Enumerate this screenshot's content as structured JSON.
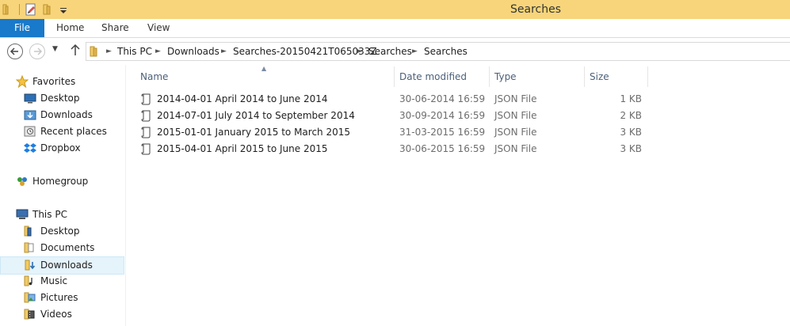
{
  "window": {
    "title": "Searches"
  },
  "ribbon": {
    "tabs": [
      "File",
      "Home",
      "Share",
      "View"
    ]
  },
  "address": {
    "crumbs": [
      "This PC",
      "Downloads",
      "Searches-20150421T065033Z",
      "Searches",
      "Searches"
    ]
  },
  "navpane": {
    "favorites": {
      "label": "Favorites",
      "items": [
        "Desktop",
        "Downloads",
        "Recent places",
        "Dropbox"
      ]
    },
    "homegroup": {
      "label": "Homegroup"
    },
    "thispc": {
      "label": "This PC",
      "items": [
        "Desktop",
        "Documents",
        "Downloads",
        "Music",
        "Pictures",
        "Videos"
      ]
    },
    "selected": "Downloads"
  },
  "filelist": {
    "columns": {
      "name": "Name",
      "date": "Date modified",
      "type": "Type",
      "size": "Size"
    },
    "rows": [
      {
        "name": "2014-04-01 April 2014 to June 2014",
        "date": "30-06-2014 16:59",
        "type": "JSON File",
        "size": "1 KB"
      },
      {
        "name": "2014-07-01 July 2014 to September 2014",
        "date": "30-09-2014 16:59",
        "type": "JSON File",
        "size": "2 KB"
      },
      {
        "name": "2015-01-01 January 2015 to March 2015",
        "date": "31-03-2015 16:59",
        "type": "JSON File",
        "size": "3 KB"
      },
      {
        "name": "2015-04-01 April 2015 to June 2015",
        "date": "30-06-2015 16:59",
        "type": "JSON File",
        "size": "3 KB"
      }
    ]
  },
  "colors": {
    "titlebar": "#f8d57a",
    "file_tab": "#1979ca",
    "selection": "#e5f3fb"
  }
}
